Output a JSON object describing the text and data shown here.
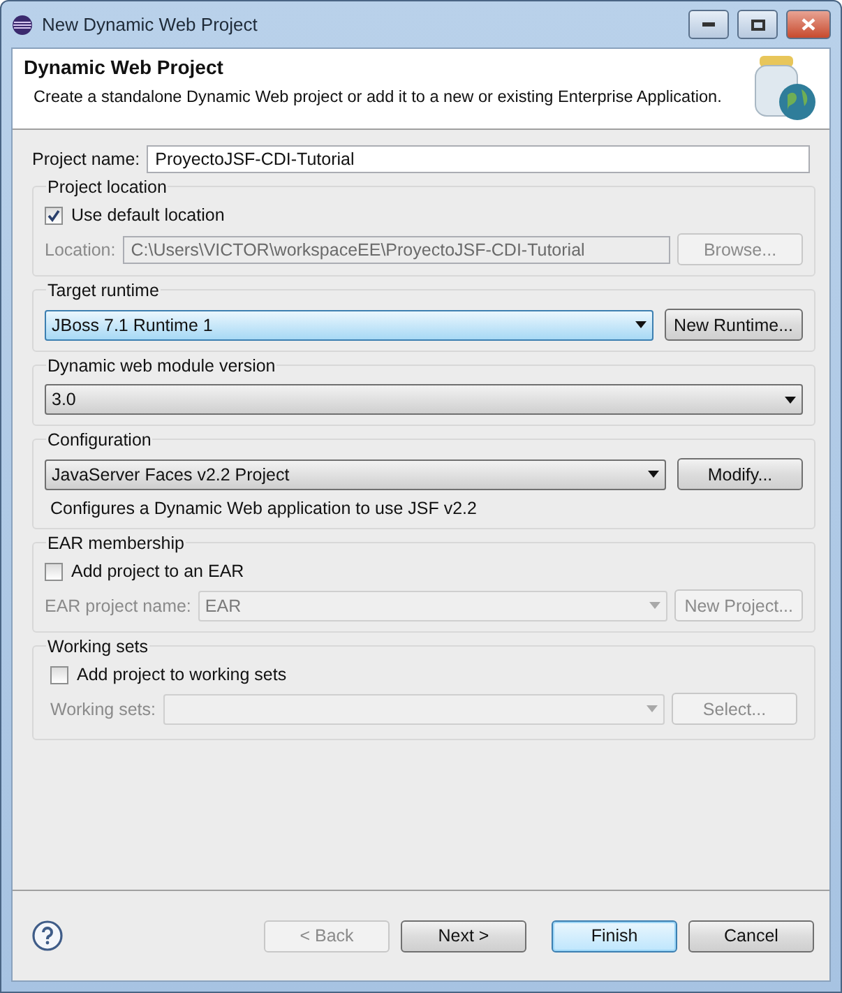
{
  "window": {
    "title": "New Dynamic Web Project"
  },
  "header": {
    "title": "Dynamic Web Project",
    "description": "Create a standalone Dynamic Web project or add it to a new or existing Enterprise Application."
  },
  "project_name": {
    "label": "Project name:",
    "value": "ProyectoJSF-CDI-Tutorial"
  },
  "project_location": {
    "title": "Project location",
    "use_default": {
      "label": "Use default location",
      "checked": true
    },
    "location": {
      "label": "Location:",
      "value": "C:\\Users\\VICTOR\\workspaceEE\\ProyectoJSF-CDI-Tutorial",
      "disabled": true
    },
    "button": {
      "label": "Browse...",
      "disabled": true
    }
  },
  "target_runtime": {
    "title": "Target runtime",
    "value": "JBoss 7.1 Runtime 1",
    "focused": true,
    "button": {
      "label": "New Runtime...",
      "disabled": false
    }
  },
  "module_version": {
    "title": "Dynamic web module version",
    "value": "3.0",
    "focused": false
  },
  "configuration": {
    "title": "Configuration",
    "value": "JavaServer Faces v2.2 Project",
    "focused": false,
    "button": {
      "label": "Modify...",
      "disabled": false
    },
    "description": "Configures a Dynamic Web application to use JSF v2.2"
  },
  "ear_membership": {
    "title": "EAR membership",
    "add": {
      "label": "Add project to an EAR",
      "checked": false
    },
    "project_name": {
      "label": "EAR project name:",
      "value": "EAR",
      "disabled": true
    },
    "button": {
      "label": "New Project...",
      "disabled": true
    }
  },
  "working_sets": {
    "title": "Working sets",
    "add": {
      "label": "Add project to working sets",
      "checked": false
    },
    "field": {
      "label": "Working sets:",
      "disabled": true
    },
    "button": {
      "label": "Select...",
      "disabled": true
    }
  },
  "buttons": [
    {
      "label": "< Back",
      "disabled": true,
      "default": false
    },
    {
      "label": "Next >",
      "disabled": false,
      "default": false
    },
    {
      "label": "Finish",
      "disabled": false,
      "default": true
    },
    {
      "label": "Cancel",
      "disabled": false,
      "default": false
    }
  ]
}
